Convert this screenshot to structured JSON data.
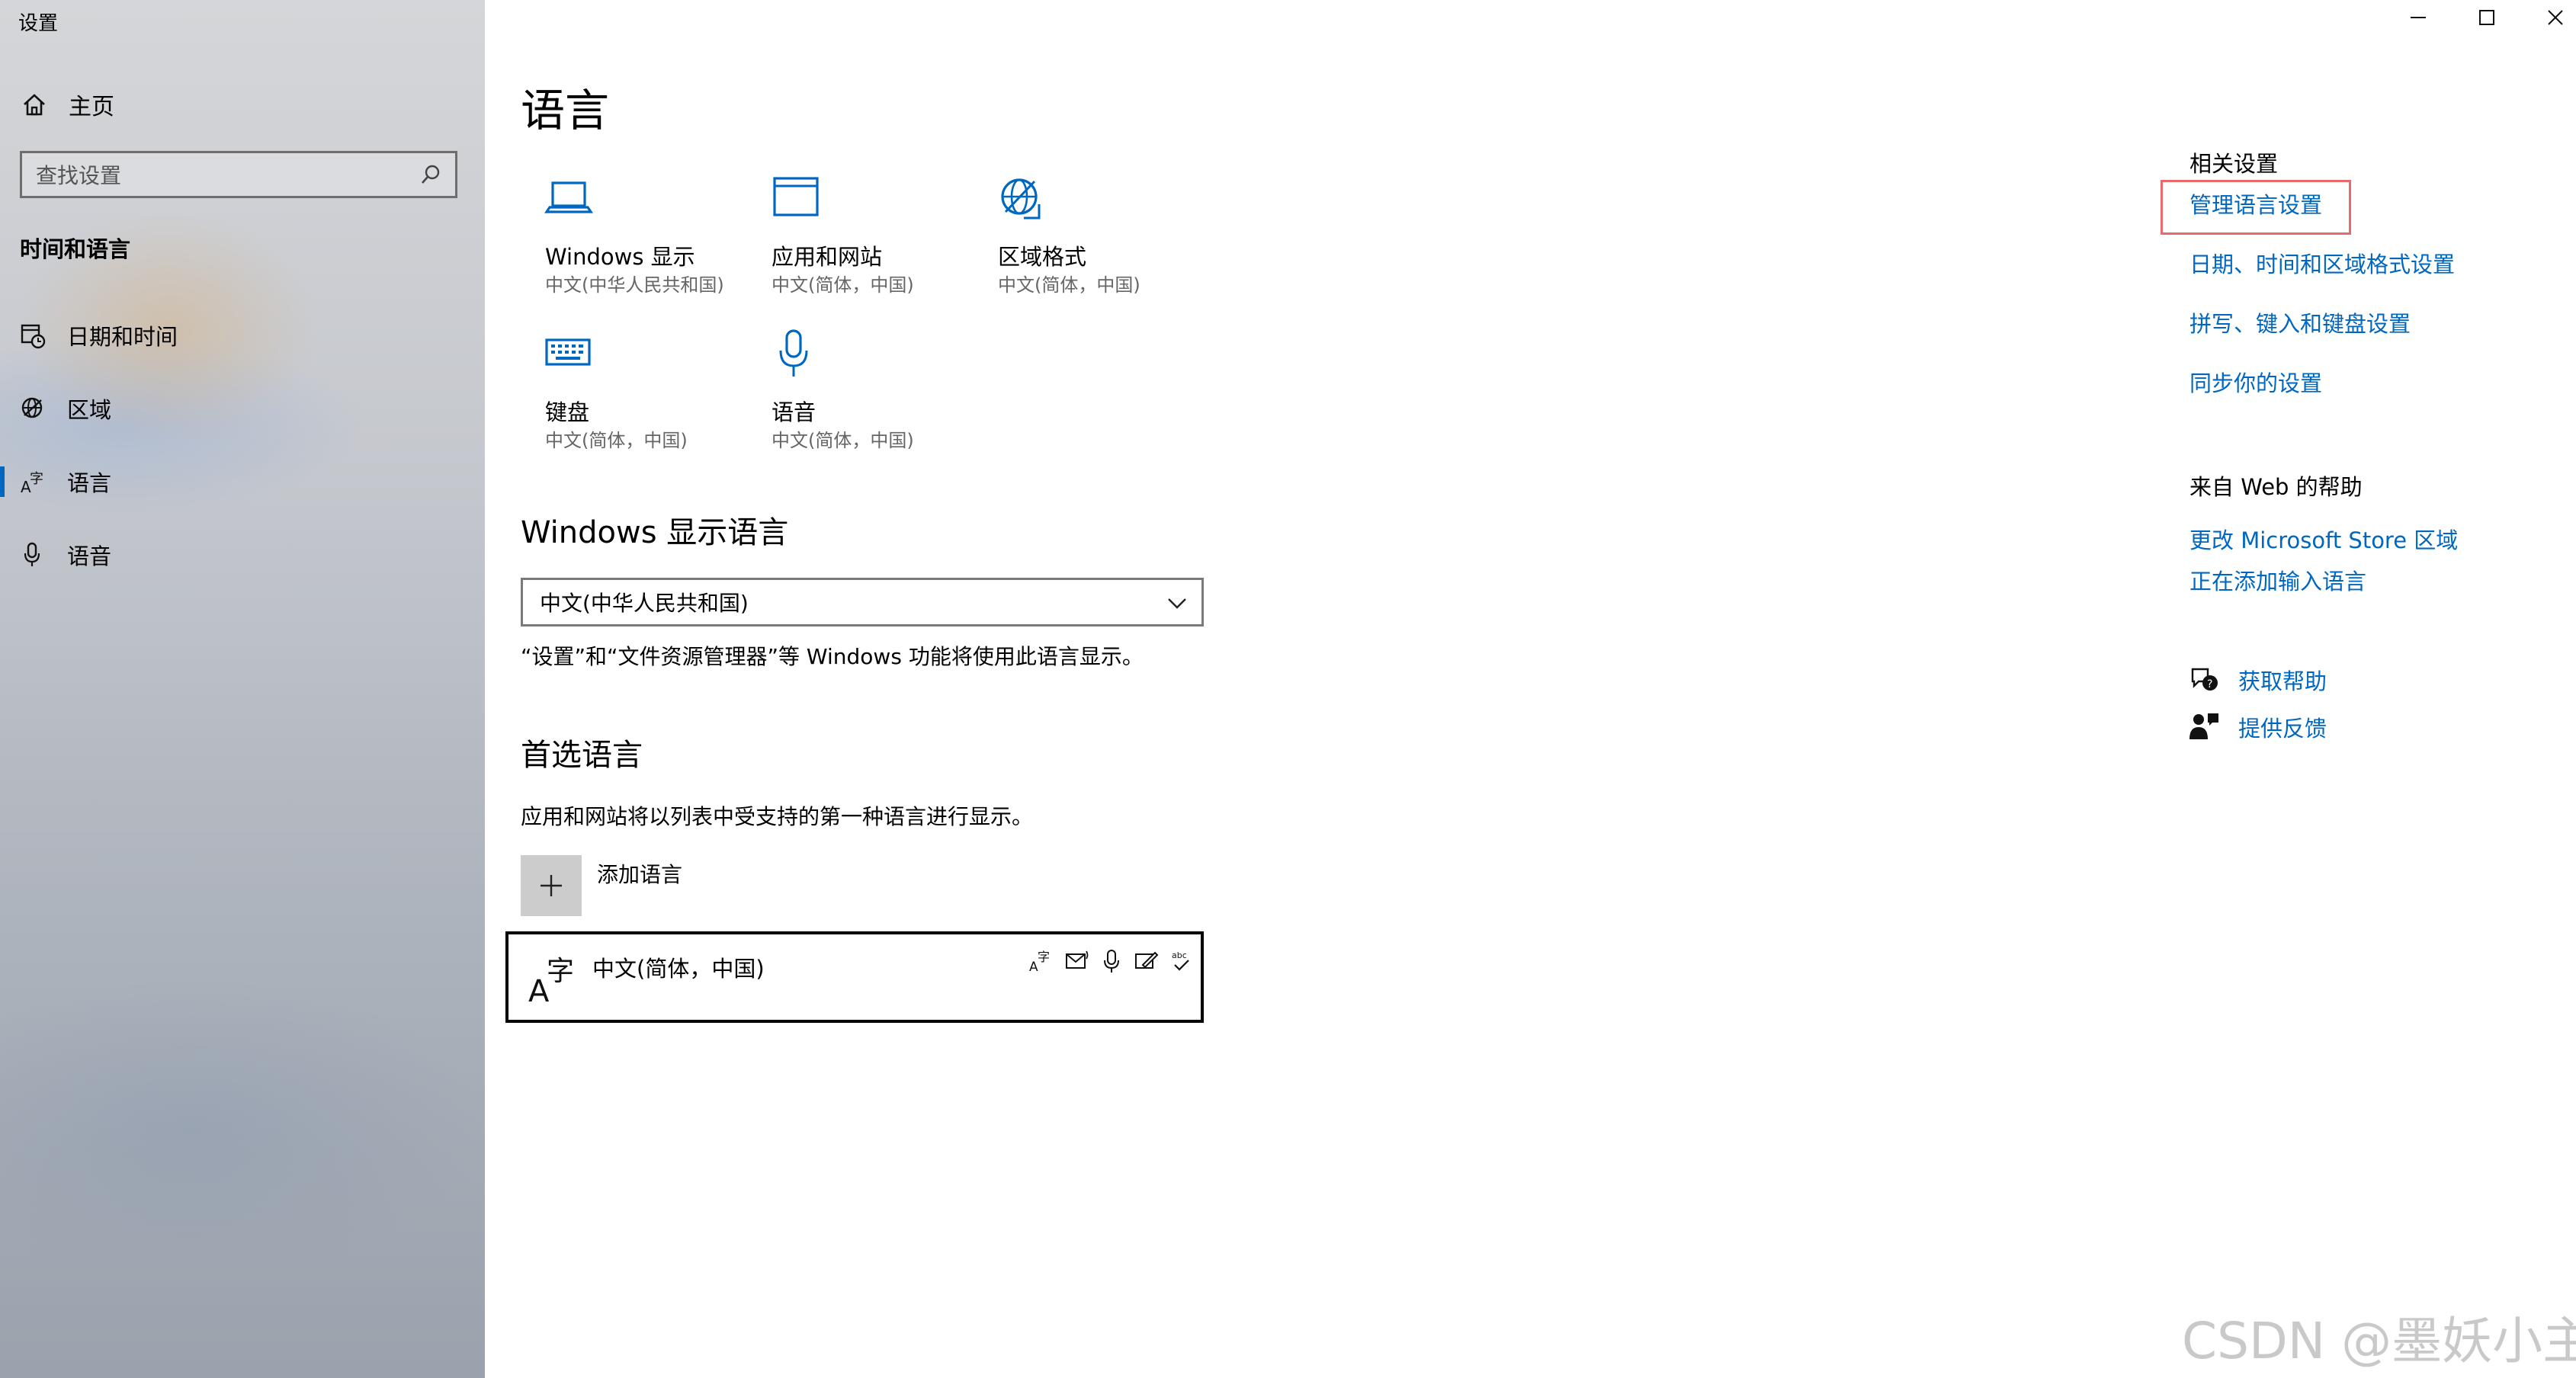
{
  "window": {
    "app_title": "设置",
    "controls": [
      "minimize",
      "maximize",
      "close"
    ]
  },
  "sidebar": {
    "home_label": "主页",
    "search_placeholder": "查找设置",
    "section_title": "时间和语言",
    "items": [
      {
        "label": "日期和时间",
        "icon": "calendar-clock-icon",
        "active": false
      },
      {
        "label": "区域",
        "icon": "globe-region-icon",
        "active": false
      },
      {
        "label": "语言",
        "icon": "language-icon",
        "active": true
      },
      {
        "label": "语音",
        "icon": "microphone-icon",
        "active": false
      }
    ]
  },
  "main": {
    "title": "语言",
    "tiles": [
      {
        "name": "Windows 显示",
        "sub": "中文(中华人民共和国)",
        "icon": "laptop-icon"
      },
      {
        "name": "应用和网站",
        "sub": "中文(简体，中国)",
        "icon": "browser-window-icon"
      },
      {
        "name": "区域格式",
        "sub": "中文(简体，中国)",
        "icon": "globe-format-icon"
      },
      {
        "name": "键盘",
        "sub": "中文(简体，中国)",
        "icon": "keyboard-icon"
      },
      {
        "name": "语音",
        "sub": "中文(简体，中国)",
        "icon": "microphone-icon"
      }
    ],
    "display_language": {
      "heading": "Windows 显示语言",
      "selected": "中文(中华人民共和国)",
      "description": "“设置”和“文件资源管理器”等 Windows 功能将使用此语言显示。"
    },
    "preferred": {
      "heading": "首选语言",
      "description": "应用和网站将以列表中受支持的第一种语言进行显示。",
      "add_label": "添加语言",
      "languages": [
        {
          "name": "中文(简体，中国)",
          "features": [
            "display-language-icon",
            "text-to-speech-icon",
            "speech-recognition-icon",
            "handwriting-icon",
            "spellcheck-icon"
          ]
        }
      ]
    }
  },
  "right": {
    "related_heading": "相关设置",
    "related_links": [
      "管理语言设置",
      "日期、时间和区域格式设置",
      "拼写、键入和键盘设置",
      "同步你的设置"
    ],
    "web_help_heading": "来自 Web 的帮助",
    "web_links": [
      "更改 Microsoft Store 区域",
      "正在添加输入语言"
    ],
    "get_help": "获取帮助",
    "feedback": "提供反馈"
  },
  "watermark": "CSDN @墨妖小主",
  "colors": {
    "accent": "#0067c0",
    "highlight_box": "#e86a6a"
  }
}
